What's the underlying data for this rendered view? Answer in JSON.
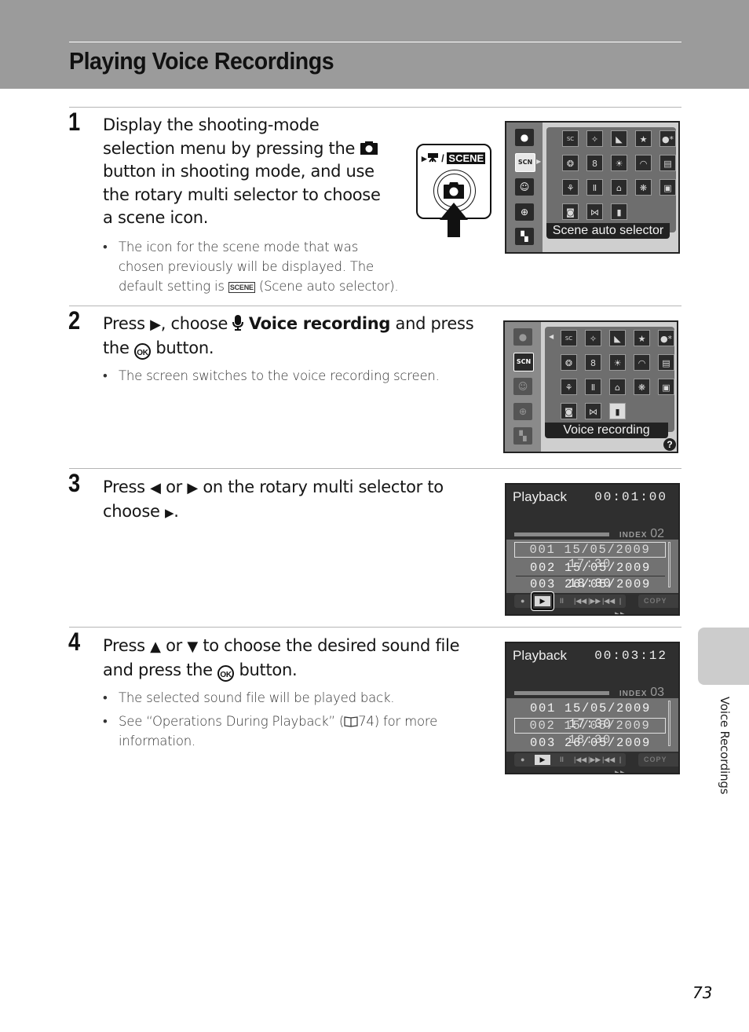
{
  "header": {
    "title": "Playing Voice Recordings"
  },
  "steps": [
    {
      "number": "1",
      "text": "Display the shooting-mode selection menu by pressing the [camera] button in shooting mode, and use the rotary multi selector to choose a scene icon.",
      "lines": [
        "Display the shooting-mode",
        "selection menu by pressing the",
        "button in shooting mode, and use",
        "the rotary multi selector to choose",
        "a scene icon."
      ],
      "bullets": [
        {
          "line1": "The icon for the scene mode that was",
          "line2": "chosen previously will be displayed. The",
          "line3a": "default setting is",
          "icon": "SCENE",
          "line3b": "(Scene auto selector)."
        }
      ]
    },
    {
      "number": "2",
      "line1a": "Press",
      "line1b": ", choose",
      "bold": "Voice recording",
      "line1c": "and press",
      "line2a": "the",
      "line2b": "button.",
      "bullets": [
        "The screen switches to the voice recording screen."
      ]
    },
    {
      "number": "3",
      "line1a": "Press",
      "line1b": "or",
      "line1c": "on the rotary multi selector to",
      "line2a": "choose",
      "line2b": "."
    },
    {
      "number": "4",
      "line1a": "Press",
      "line1b": "or",
      "line1c": "to choose the desired sound file",
      "line2a": "and press the",
      "line2b": "button.",
      "bullets": [
        "The selected sound file will be played back.",
        {
          "a": "See “Operations During Playback” (",
          "book": "⬚",
          "ref": "74) for more",
          "b": "information."
        }
      ]
    }
  ],
  "glyphs": {
    "camera": "◘",
    "right_triangle": "▶",
    "left_triangle": "◀",
    "up_triangle": "▲",
    "down_triangle": "▼",
    "play_small": "⏵",
    "mic": "🎙",
    "ok": "OK",
    "book": "🕮"
  },
  "camera_button": {
    "label_prefix": "▸🎥 /",
    "scene_word": "SCENE"
  },
  "menu_screen_1": {
    "caption": "Scene auto selector",
    "side_icons": [
      "camera-icon",
      "scene-icon",
      "smile-icon",
      "target-icon",
      "movie-icon"
    ],
    "grid_icons": [
      [
        "SC",
        "✧",
        "◣",
        "★",
        "●*"
      ],
      [
        "❂",
        "8",
        "☀",
        "◠",
        "▤"
      ],
      [
        "⚘",
        "Ⅱ",
        "⌂",
        "❋",
        "▣"
      ],
      [
        "◙",
        "⋈",
        "▮"
      ]
    ]
  },
  "menu_screen_2": {
    "caption": "Voice recording",
    "help": "?"
  },
  "playback_screen_1": {
    "title": "Playback",
    "time": "00:01:00",
    "index_label": "INDEX",
    "index_value": "02",
    "rows": [
      "001  15/05/2009  17:30",
      "002  15/05/2009  18:30",
      "003  26/05/2009  13:00"
    ],
    "selected_row": 0,
    "controls": [
      "●",
      "▶",
      "II",
      "◀◀",
      "▶▶",
      "|◀◀",
      "▶▶|"
    ],
    "copy_label": "COPY",
    "play_highlighted": true
  },
  "playback_screen_2": {
    "title": "Playback",
    "time": "00:03:12",
    "index_label": "INDEX",
    "index_value": "03",
    "rows": [
      "001  15/05/2009  17:30",
      "002  15/05/2009  18:30",
      "003  26/05/2009  13:00"
    ],
    "selected_row": 1,
    "controls": [
      "●",
      "▶",
      "II",
      "◀◀",
      "▶▶",
      "|◀◀",
      "▶▶|"
    ],
    "copy_label": "COPY",
    "play_highlighted": false
  },
  "side_tab": {
    "label": "Voice Recordings"
  },
  "page_number": "73"
}
